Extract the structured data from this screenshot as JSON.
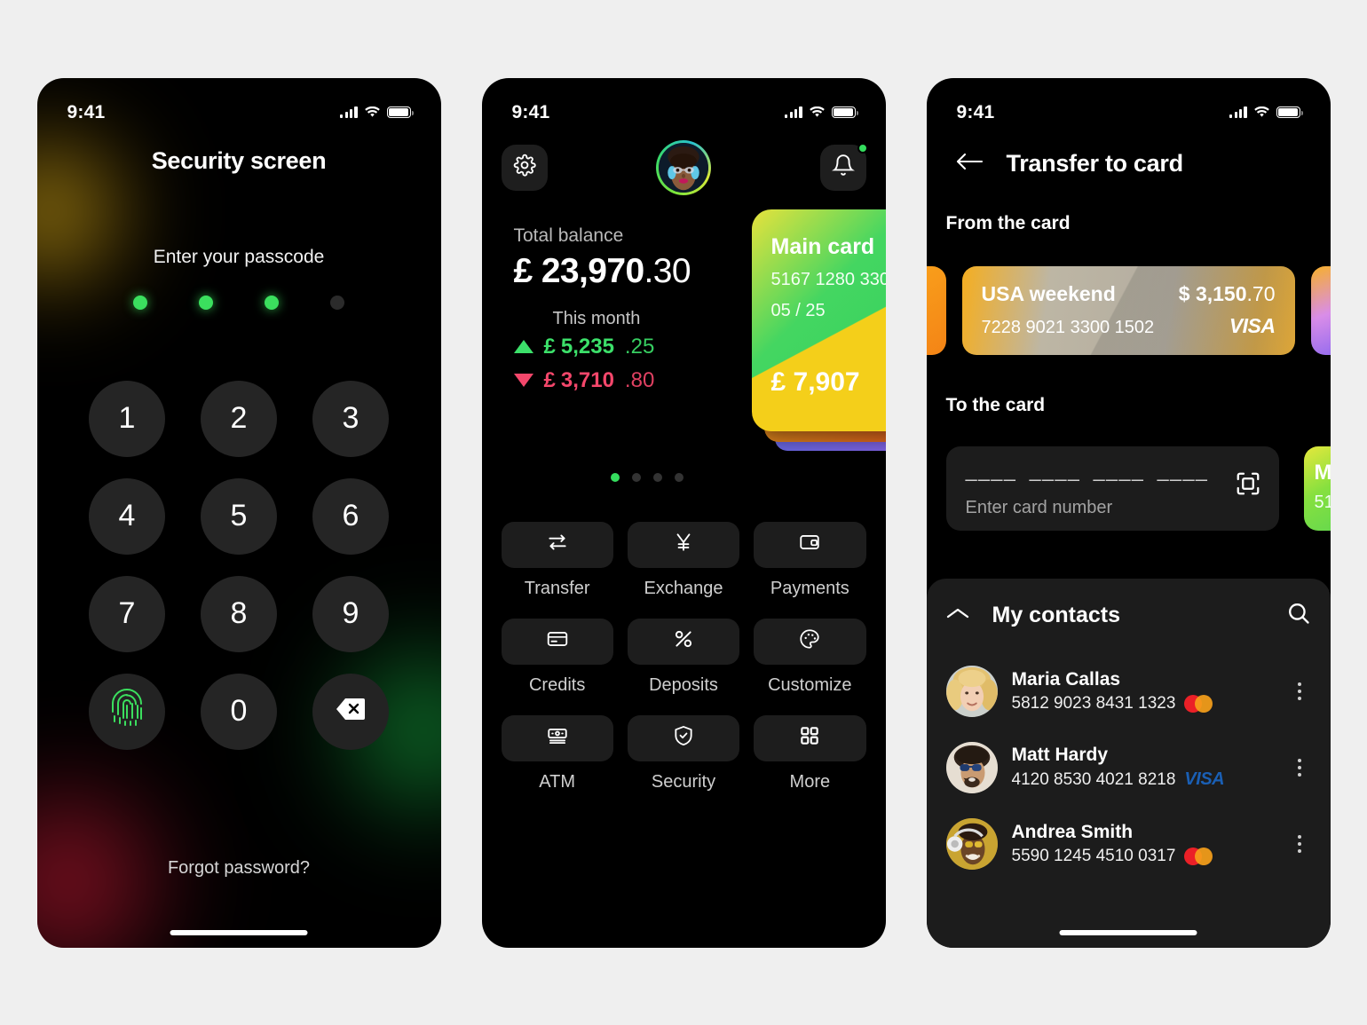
{
  "statusbar": {
    "time": "9:41"
  },
  "security_screen": {
    "title": "Security screen",
    "subtitle": "Enter your passcode",
    "passcode_dots": [
      true,
      true,
      true,
      false
    ],
    "keys": [
      "1",
      "2",
      "3",
      "4",
      "5",
      "6",
      "7",
      "8",
      "9"
    ],
    "fingerprint_label": "fingerprint",
    "zero_key": "0",
    "backspace_label": "backspace",
    "forgot_label": "Forgot password?",
    "accent_green": "#3bdf5e"
  },
  "dashboard": {
    "settings_label": "Settings",
    "notifications_label": "Notifications",
    "avatar_label": "Profile",
    "balance_label": "Total balance",
    "balance_currency": "£",
    "balance_main": "23,970",
    "balance_cents": ".30",
    "month_label": "This month",
    "income_currency": "£",
    "income_main": "5,235",
    "income_cents": ".25",
    "outcome_currency": "£",
    "outcome_main": "3,710",
    "outcome_cents": ".80",
    "income_color": "#3ce06a",
    "outcome_color": "#f4476b",
    "card": {
      "name": "Main card",
      "number": "5167 1280 330",
      "expiry": "05 / 25",
      "balance": "£ 7,907"
    },
    "pager": {
      "count": 4,
      "active": 0
    },
    "actions": [
      {
        "label": "Transfer",
        "icon": "transfer-icon"
      },
      {
        "label": "Exchange",
        "icon": "yen-exchange-icon"
      },
      {
        "label": "Payments",
        "icon": "wallet-icon"
      },
      {
        "label": "Credits",
        "icon": "credit-card-icon"
      },
      {
        "label": "Deposits",
        "icon": "percent-icon"
      },
      {
        "label": "Customize",
        "icon": "palette-icon"
      },
      {
        "label": "ATM",
        "icon": "banknote-icon"
      },
      {
        "label": "Security",
        "icon": "shield-check-icon"
      },
      {
        "label": "More",
        "icon": "grid-icon"
      }
    ]
  },
  "transfer": {
    "back_label": "Back",
    "title": "Transfer to card",
    "from_label": "From the card",
    "to_label": "To the card",
    "from_card": {
      "name": "USA weekend",
      "amount_currency": "$",
      "amount_main": "3,150",
      "amount_cents": ".70",
      "number": "7228 9021 3300 1502",
      "brand": "VISA"
    },
    "card_input": {
      "mask": "———— ———— ———— ————",
      "placeholder": "Enter card number",
      "scan_icon": "scan-card-icon"
    },
    "peek_card": {
      "name_fragment": "M",
      "number_fragment": "51"
    },
    "contacts": {
      "title": "My contacts",
      "collapse_icon": "chevron-up-icon",
      "search_icon": "search-icon",
      "items": [
        {
          "name": "Maria Callas",
          "card": "5812 9023 8431 1323",
          "brand": "mastercard"
        },
        {
          "name": "Matt Hardy",
          "card": "4120 8530 4021 8218",
          "brand": "visa"
        },
        {
          "name": "Andrea Smith",
          "card": "5590 1245 4510 0317",
          "brand": "mastercard"
        }
      ]
    }
  }
}
